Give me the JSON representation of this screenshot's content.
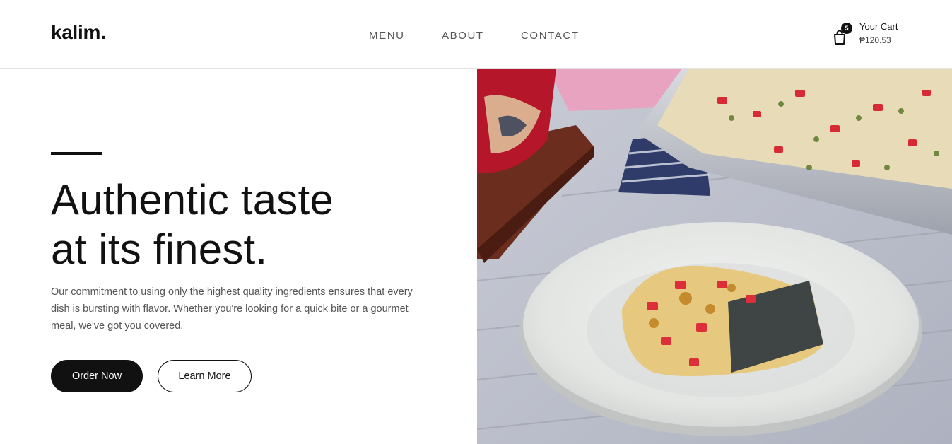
{
  "brand": {
    "logo": "kalim."
  },
  "nav": {
    "items": [
      "MENU",
      "ABOUT",
      "CONTACT"
    ]
  },
  "cart": {
    "label": "Your Cart",
    "total": "₱120.53",
    "count": "5",
    "icon": "shopping-bag-icon"
  },
  "hero": {
    "headline_line1": "Authentic taste",
    "headline_line2": "at its finest.",
    "description": "Our commitment to using only the highest quality ingredients ensures that every dish is bursting with flavor. Whether you're looking for a quick bite or a gourmet meal, we've got you covered.",
    "primary_button": "Order Now",
    "secondary_button": "Learn More"
  },
  "colors": {
    "text": "#111111",
    "muted": "#555555",
    "background": "#ffffff"
  }
}
